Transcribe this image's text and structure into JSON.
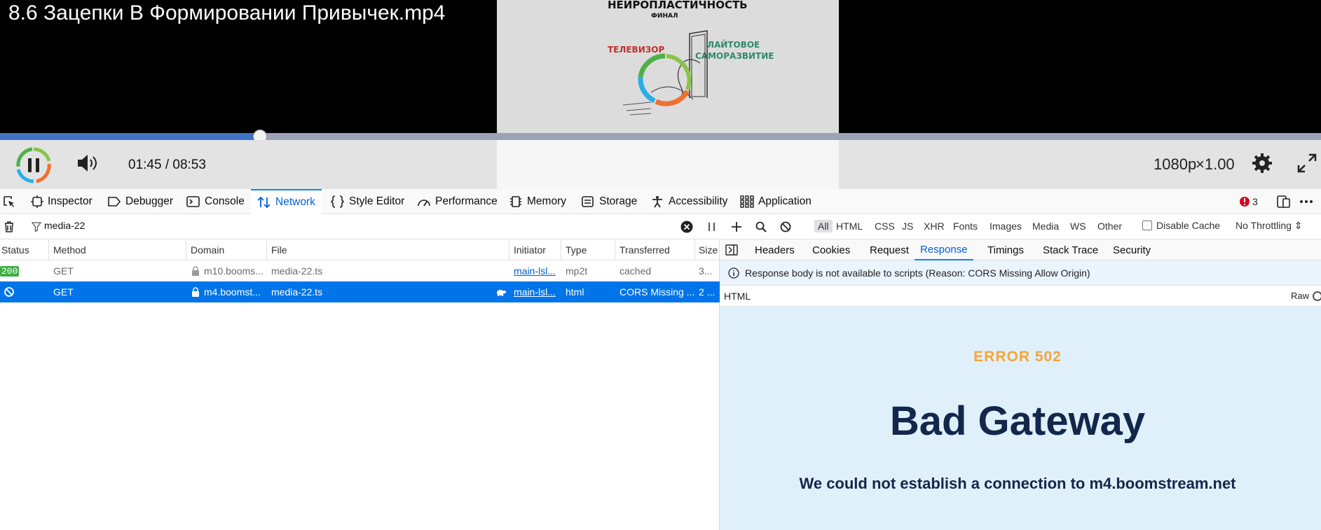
{
  "player": {
    "title": "8.6 Зацепки В Формировании Привычек.mp4",
    "frame_heading": "НЕЙРОПЛАСТИЧНОСТЬ",
    "frame_sub": "ФИНАЛ",
    "frame_left": "ТЕЛЕВИЗОР",
    "frame_right_1": "ЛАЙТОВОЕ",
    "frame_right_2": "САМОРАЗВИТИЕ",
    "time": "01:45 / 08:53",
    "quality": "1080p",
    "speed": "×1.00",
    "progress": 0.197
  },
  "toolbox": {
    "tabs": [
      "Inspector",
      "Debugger",
      "Console",
      "Network",
      "Style Editor",
      "Performance",
      "Memory",
      "Storage",
      "Accessibility",
      "Application"
    ],
    "active_tab": "Network",
    "error_count": "3"
  },
  "filter": {
    "value": "media-22",
    "types": [
      "All",
      "HTML",
      "CSS",
      "JS",
      "XHR",
      "Fonts",
      "Images",
      "Media",
      "WS",
      "Other"
    ],
    "selected_type": "All",
    "disable_cache": "Disable Cache",
    "throttling": "No Throttling ⇕"
  },
  "table": {
    "headers": [
      "Status",
      "Method",
      "Domain",
      "File",
      "Initiator",
      "Type",
      "Transferred",
      "Size"
    ],
    "rows": [
      {
        "status": "200",
        "method": "GET",
        "domain": "m10.booms...",
        "file": "media-22.ts",
        "initiator": "main-lsl...",
        "type": "mp2t",
        "transferred": "cached",
        "size": "3..."
      },
      {
        "status": "",
        "method": "GET",
        "domain": "m4.boomst...",
        "file": "media-22.ts",
        "initiator": "main-lsl...",
        "type": "html",
        "transferred": "CORS Missing ...",
        "size": "2 ..."
      }
    ]
  },
  "details": {
    "tabs": [
      "Headers",
      "Cookies",
      "Request",
      "Response",
      "Timings",
      "Stack Trace",
      "Security"
    ],
    "active_tab": "Response",
    "notice": "Response body is not available to scripts (Reason: CORS Missing Allow Origin)",
    "format_label": "HTML",
    "raw_label": "Raw",
    "error_code": "ERROR 502",
    "error_title": "Bad Gateway",
    "error_desc": "We could not establish a connection to m4.boomstream.net"
  },
  "colors": {
    "accent": "#0a84ff",
    "selected_row": "#0074e8",
    "error_orange": "#f5a53a",
    "error_navy": "#12274a",
    "preview_bg": "#e0f0fb"
  }
}
